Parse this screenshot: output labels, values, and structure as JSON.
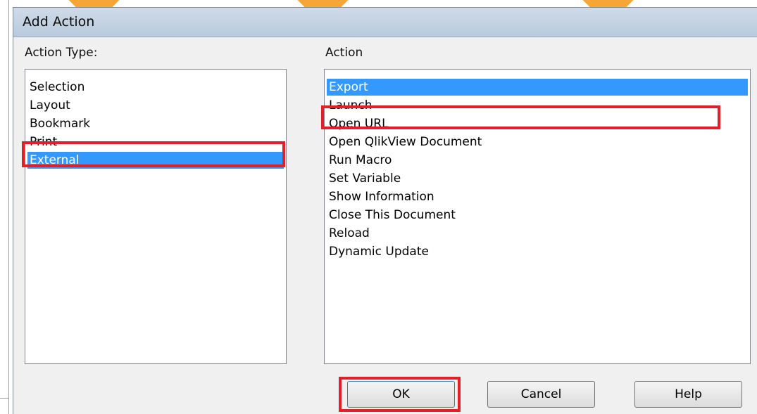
{
  "dialog": {
    "title": "Add Action"
  },
  "action_type": {
    "label": "Action Type:",
    "items": [
      "Selection",
      "Layout",
      "Bookmark",
      "Print",
      "External"
    ],
    "selected": "External"
  },
  "action": {
    "label": "Action",
    "items": [
      "Export",
      "Launch",
      "Open URL",
      "Open QlikView Document",
      "Run Macro",
      "Set Variable",
      "Show Information",
      "Close This Document",
      "Reload",
      "Dynamic Update"
    ],
    "selected": "Export",
    "highlighted": "Open URL"
  },
  "buttons": {
    "ok": "OK",
    "cancel": "Cancel",
    "help": "Help"
  },
  "colors": {
    "selection": "#3399ff",
    "highlight_annotation": "#e1202a",
    "decoration": "#f5a637"
  }
}
